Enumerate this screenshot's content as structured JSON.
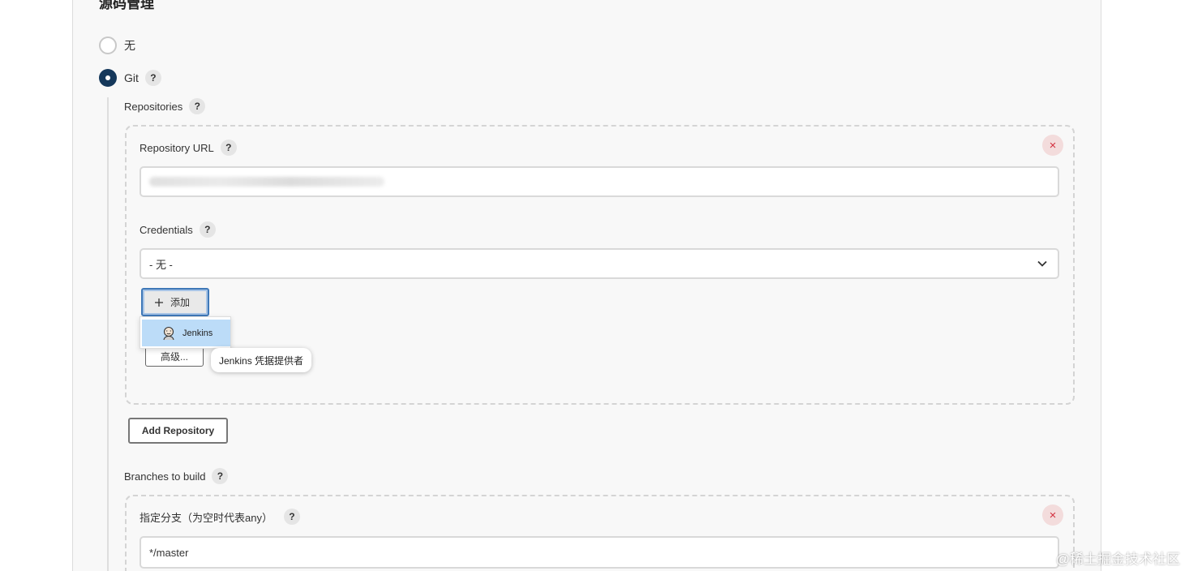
{
  "section": {
    "title": "源码管理"
  },
  "scm_options": {
    "none_label": "无",
    "git_label": "Git"
  },
  "help_glyph": "?",
  "repositories": {
    "label": "Repositories",
    "repository_url_label": "Repository URL",
    "repository_url_value": "",
    "credentials_label": "Credentials",
    "credentials_selected": "- 无 -",
    "add_button_label": "添加",
    "dropdown_item_label": "Jenkins",
    "advanced_button_label": "高级...",
    "tooltip_text": "Jenkins 凭据提供者",
    "add_repository_label": "Add Repository"
  },
  "branches": {
    "label": "Branches to build",
    "specifier_label": "指定分支（为空时代表any）",
    "specifier_value": "*/master"
  },
  "delete_glyph": "×",
  "watermark": "@稀土掘金技术社区",
  "colors": {
    "radio_checked": "#15385b",
    "delete_bg": "#f3dcdc",
    "delete_fg": "#d3303f",
    "dropdown_highlight": "#bcdcf8",
    "focus_ring": "#3f78b8"
  }
}
